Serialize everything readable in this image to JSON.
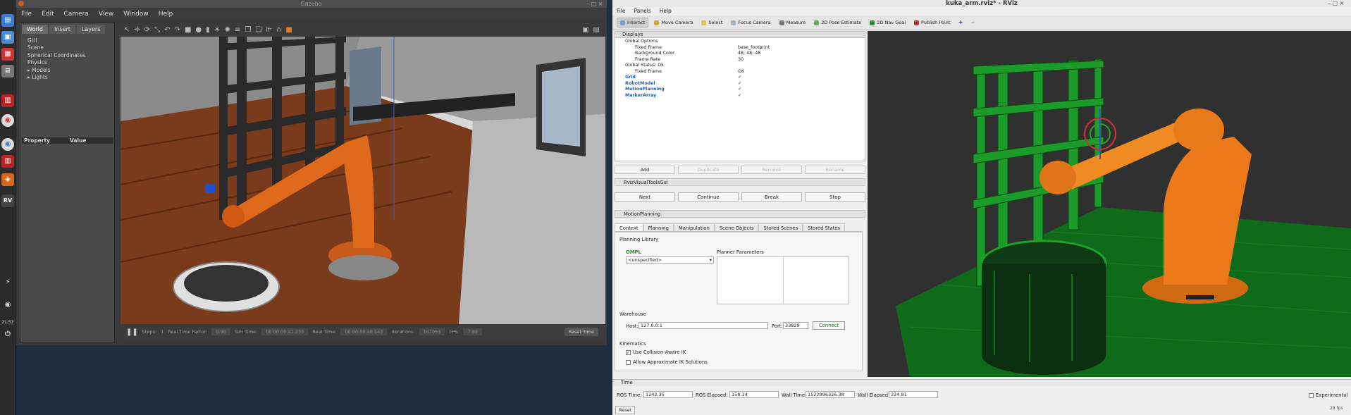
{
  "gazebo": {
    "title": "Gazebo",
    "menu": [
      "File",
      "Edit",
      "Camera",
      "View",
      "Window",
      "Help"
    ],
    "tabs": [
      "World",
      "Insert",
      "Layers"
    ],
    "tree": [
      "GUI",
      "Scene",
      "Spherical Coordinates",
      "Physics",
      "Models",
      "Lights"
    ],
    "prop_header": {
      "property": "Property",
      "value": "Value"
    },
    "bottom": {
      "steps_label": "Steps:",
      "steps_value": "1",
      "rtf_label": "Real Time Factor:",
      "rtf_value": "0.98",
      "sim_label": "Sim Time:",
      "sim_value": "00 00:00:41.233",
      "real_label": "Real Time:",
      "real_value": "00 00:00:48.543",
      "iter_label": "Iterations:",
      "iter_value": "167053",
      "fps_label": "FPS:",
      "fps_value": "7.88",
      "reset_label": "Reset Time"
    }
  },
  "rviz": {
    "title": "kuka_arm.rviz* - RViz",
    "menu": [
      "File",
      "Panels",
      "Help"
    ],
    "toolbar": [
      {
        "label": "Interact",
        "icon": "interact-icon",
        "selected": true,
        "color": "#7a9cc6"
      },
      {
        "label": "Move Camera",
        "icon": "move-camera-icon",
        "selected": false,
        "color": "#c9a73a"
      },
      {
        "label": "Select",
        "icon": "select-icon",
        "selected": false,
        "color": "#e2c83a"
      },
      {
        "label": "Focus Camera",
        "icon": "focus-camera-icon",
        "selected": false,
        "color": "#9fb3c8"
      },
      {
        "label": "Measure",
        "icon": "measure-icon",
        "selected": false,
        "color": "#777777"
      },
      {
        "label": "2D Pose Estimate",
        "icon": "pose-estimate-icon",
        "selected": false,
        "color": "#5ab04a"
      },
      {
        "label": "2D Nav Goal",
        "icon": "nav-goal-icon",
        "selected": false,
        "color": "#2f8a3a"
      },
      {
        "label": "Publish Point",
        "icon": "publish-point-icon",
        "selected": false,
        "color": "#c03030"
      }
    ],
    "displays": {
      "header": "Displays",
      "rows": [
        {
          "indent": 0,
          "key": "Global Options",
          "value": "",
          "style": "normal"
        },
        {
          "indent": 1,
          "key": "Fixed Frame",
          "value": "base_footprint",
          "style": "normal"
        },
        {
          "indent": 1,
          "key": "Background Color",
          "value": "48; 48; 48",
          "style": "normal"
        },
        {
          "indent": 1,
          "key": "Frame Rate",
          "value": "30",
          "style": "normal"
        },
        {
          "indent": 0,
          "key": "Global Status: Ok",
          "value": "",
          "style": "normal"
        },
        {
          "indent": 1,
          "key": "Fixed Frame",
          "value": "OK",
          "style": "normal"
        },
        {
          "indent": 0,
          "key": "Grid",
          "value": "✓",
          "style": "blue"
        },
        {
          "indent": 0,
          "key": "RobotModel",
          "value": "✓",
          "style": "blue"
        },
        {
          "indent": 0,
          "key": "MotionPlanning",
          "value": "✓",
          "style": "blue"
        },
        {
          "indent": 0,
          "key": "MarkerArray",
          "value": "✓",
          "style": "blue"
        }
      ],
      "buttons": [
        {
          "label": "Add",
          "disabled": false
        },
        {
          "label": "Duplicate",
          "disabled": true
        },
        {
          "label": "Remove",
          "disabled": true
        },
        {
          "label": "Rename",
          "disabled": true
        }
      ]
    },
    "visual_tools": {
      "header": "RvizVisualToolsGui",
      "buttons": [
        "Next",
        "Continue",
        "Break",
        "Stop"
      ]
    },
    "motion_planning": {
      "header": "MotionPlanning",
      "tabs": [
        "Context",
        "Planning",
        "Manipulation",
        "Scene Objects",
        "Stored Scenes",
        "Stored States"
      ],
      "planning_library": "Planning Library",
      "ompl": "OMPL",
      "planner_select": "<unspecified>",
      "planner_params": "Planner Parameters",
      "warehouse": "Warehouse",
      "host_label": "Host:",
      "host_value": "127.0.0.1",
      "port_label": "Port:",
      "port_value": "33829",
      "connect_label": "Connect",
      "kinematics": "Kinematics",
      "use_collision": "Use Collision-Aware IK",
      "use_collision_checked": true,
      "approx_ik": "Allow Approximate IK Solutions",
      "approx_ik_checked": false
    },
    "time": {
      "header": "Time",
      "ros_time_label": "ROS Time:",
      "ros_time": "1242.35",
      "ros_elapsed_label": "ROS Elapsed:",
      "ros_elapsed": "158.14",
      "wall_time_label": "Wall Time:",
      "wall_time": "1522996326.38",
      "wall_elapsed_label": "Wall Elapsed:",
      "wall_elapsed": "224.81",
      "experimental": "Experimental",
      "reset": "Reset",
      "fps": "28 fps"
    }
  },
  "launcher": {
    "clock": "21:52"
  }
}
